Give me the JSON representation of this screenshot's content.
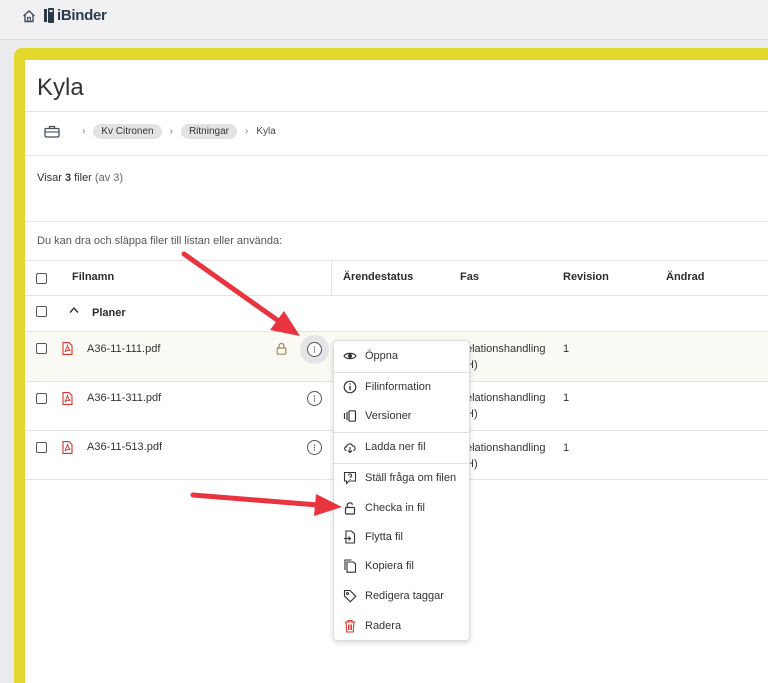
{
  "app": {
    "name": "iBinder"
  },
  "page": {
    "title": "Kyla"
  },
  "breadcrumb": [
    "Kv Citronen",
    "Ritningar",
    "Kyla"
  ],
  "summary": {
    "prefix": "Visar",
    "count": "3",
    "unit": "filer",
    "total": "(av 3)"
  },
  "hint": "Du kan dra och släppa filer till listan eller använda:",
  "columns": [
    "Filnamn",
    "Ärendestatus",
    "Fas",
    "Revision",
    "Ändrad"
  ],
  "group": {
    "label": "Planer"
  },
  "files": [
    {
      "name": "A36-11-111.pdf",
      "fas_line1": "elationshandling",
      "fas_line2": "H)",
      "revision": "1"
    },
    {
      "name": "A36-11-311.pdf",
      "fas_line1": "elationshandling",
      "fas_line2": "H)",
      "revision": "1"
    },
    {
      "name": "A36-11-513.pdf",
      "fas_line1": "elationshandling",
      "fas_line2": "H)",
      "revision": "1"
    }
  ],
  "context_menu": [
    {
      "label": "Öppna",
      "icon": "eye-icon"
    },
    {
      "label": "Filinformation",
      "icon": "info-icon"
    },
    {
      "label": "Versioner",
      "icon": "versions-icon"
    },
    {
      "label": "Ladda ner fil",
      "icon": "cloud-download-icon"
    },
    {
      "label": "Ställ fråga om filen",
      "icon": "question-bubble-icon"
    },
    {
      "label": "Checka in fil",
      "icon": "lock-open-icon"
    },
    {
      "label": "Flytta fil",
      "icon": "move-file-icon"
    },
    {
      "label": "Kopiera fil",
      "icon": "copy-icon"
    },
    {
      "label": "Redigera taggar",
      "icon": "tag-icon"
    },
    {
      "label": "Radera",
      "icon": "trash-icon"
    }
  ],
  "colors": {
    "frame": "#e3d92e",
    "pdf": "#d9342b",
    "arrow": "#e8343f",
    "trash": "#d9342b"
  }
}
